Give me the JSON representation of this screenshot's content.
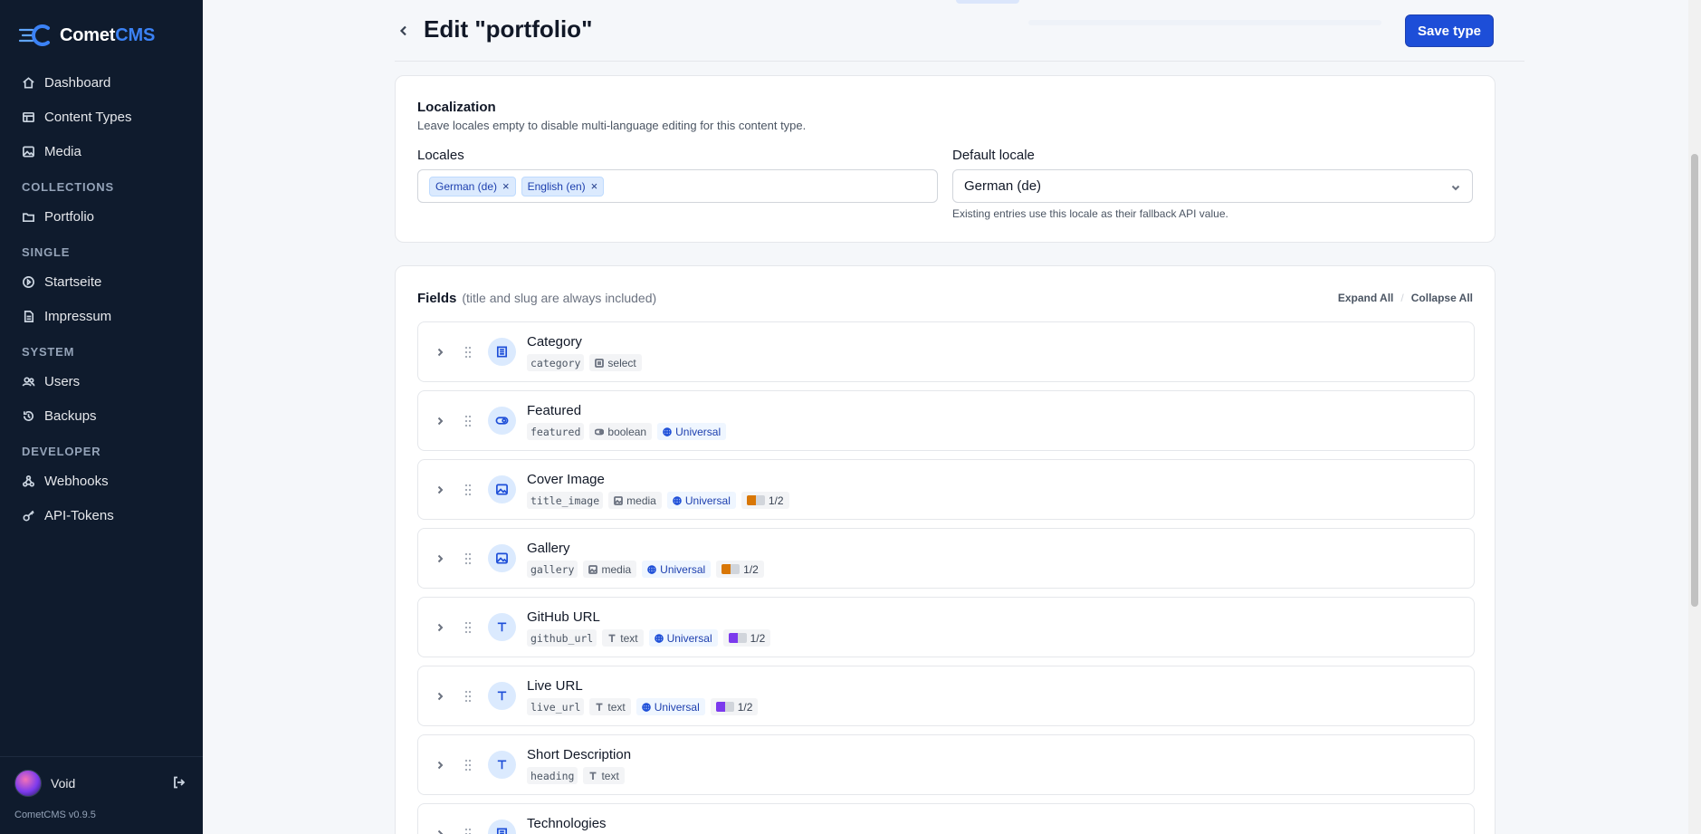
{
  "app": {
    "name_prefix": "Comet",
    "name_suffix": "CMS",
    "version": "CometCMS v0.9.5"
  },
  "sidebar": {
    "main": [
      {
        "label": "Dashboard",
        "icon": "home-icon"
      },
      {
        "label": "Content Types",
        "icon": "content-types-icon"
      },
      {
        "label": "Media",
        "icon": "image-icon"
      }
    ],
    "sections": [
      {
        "title": "COLLECTIONS",
        "items": [
          {
            "label": "Portfolio",
            "icon": "folder-icon"
          }
        ]
      },
      {
        "title": "SINGLE",
        "items": [
          {
            "label": "Startseite",
            "icon": "single-page-icon"
          },
          {
            "label": "Impressum",
            "icon": "document-icon"
          }
        ]
      },
      {
        "title": "SYSTEM",
        "items": [
          {
            "label": "Users",
            "icon": "users-icon"
          },
          {
            "label": "Backups",
            "icon": "history-icon"
          }
        ]
      },
      {
        "title": "DEVELOPER",
        "items": [
          {
            "label": "Webhooks",
            "icon": "webhook-icon"
          },
          {
            "label": "API-Tokens",
            "icon": "key-icon"
          }
        ]
      }
    ],
    "user": {
      "name": "Void"
    }
  },
  "header": {
    "title": "Edit \"portfolio\"",
    "save_label": "Save type"
  },
  "localization": {
    "title": "Localization",
    "description": "Leave locales empty to disable multi-language editing for this content type.",
    "locales_label": "Locales",
    "locales": [
      "German (de)",
      "English (en)"
    ],
    "remove_symbol": "×",
    "default_label": "Default locale",
    "default_value": "German (de)",
    "default_help": "Existing entries use this locale as their fallback API value."
  },
  "fields_section": {
    "title": "Fields",
    "note": "(title and slug are always included)",
    "expand_all": "Expand All",
    "separator": "/",
    "collapse_all": "Collapse All"
  },
  "colors": {
    "primary": "#1d4ed8",
    "sidebar": "#0f1b2d",
    "width_orange": "#d97706",
    "width_purple": "#7c3aed"
  },
  "fields": [
    {
      "title": "Category",
      "key": "category",
      "type": "select",
      "icon": "select-icon",
      "universal": "",
      "width": "",
      "width_color": ""
    },
    {
      "title": "Featured",
      "key": "featured",
      "type": "boolean",
      "icon": "toggle-icon",
      "universal": "Universal",
      "width": "",
      "width_color": ""
    },
    {
      "title": "Cover Image",
      "key": "title_image",
      "type": "media",
      "icon": "image-icon",
      "universal": "Universal",
      "width": "1/2",
      "width_color": "#d97706"
    },
    {
      "title": "Gallery",
      "key": "gallery",
      "type": "media",
      "icon": "image-icon",
      "universal": "Universal",
      "width": "1/2",
      "width_color": "#d97706"
    },
    {
      "title": "GitHub URL",
      "key": "github_url",
      "type": "text",
      "icon": "text-icon",
      "universal": "Universal",
      "width": "1/2",
      "width_color": "#7c3aed"
    },
    {
      "title": "Live URL",
      "key": "live_url",
      "type": "text",
      "icon": "text-icon",
      "universal": "Universal",
      "width": "1/2",
      "width_color": "#7c3aed"
    },
    {
      "title": "Short Description",
      "key": "heading",
      "type": "text",
      "icon": "text-icon",
      "universal": "",
      "width": "",
      "width_color": ""
    },
    {
      "title": "Technologies",
      "key": "",
      "type": "",
      "icon": "select-icon",
      "universal": "",
      "width": "",
      "width_color": ""
    }
  ]
}
